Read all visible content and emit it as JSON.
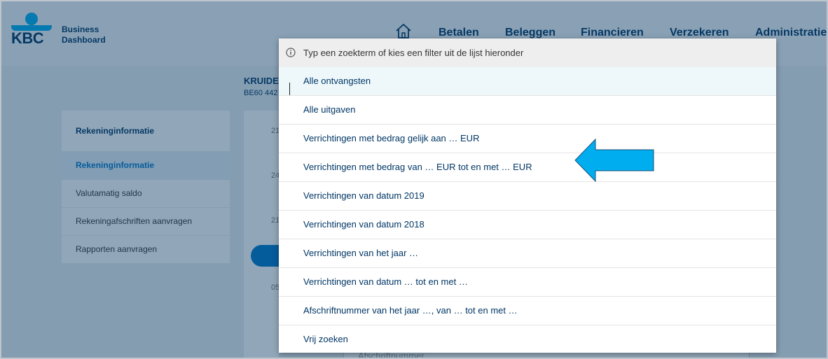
{
  "header": {
    "logo_text": "KBC",
    "brand_line1": "Business",
    "brand_line2": "Dashboard",
    "nav": [
      "Betalen",
      "Beleggen",
      "Financieren",
      "Verzekeren",
      "Administratie"
    ]
  },
  "account": {
    "title": "KRUIDE",
    "iban": "BE60 442"
  },
  "sidebar": {
    "header": "Rekeninginformatie",
    "items": [
      {
        "label": "Rekeninginformatie",
        "active": true
      },
      {
        "label": "Valutamatig saldo",
        "active": false
      },
      {
        "label": "Rekeningafschriften aanvragen",
        "active": false
      },
      {
        "label": "Rapporten aanvragen",
        "active": false
      }
    ]
  },
  "dates": [
    "21",
    "24",
    "21",
    "05"
  ],
  "bottom_field": {
    "placeholder": "Afschriftnummer"
  },
  "dropdown": {
    "hint": "Typ een zoekterm of kies een filter uit de lijst hieronder",
    "options": [
      "Alle ontvangsten",
      "Alle uitgaven",
      "Verrichtingen met bedrag gelijk aan  … EUR",
      "Verrichtingen met bedrag van  … EUR tot en met  … EUR",
      "Verrichtingen van datum 2019",
      "Verrichtingen van datum 2018",
      "Verrichtingen van het jaar  …",
      "Verrichtingen van datum  …  tot en met  …",
      "Afschriftnummer van het jaar  …, van  …  tot en met  …",
      "Vrij zoeken"
    ]
  },
  "colors": {
    "primary": "#003665",
    "accent": "#00aeef",
    "link": "#0077c8"
  }
}
